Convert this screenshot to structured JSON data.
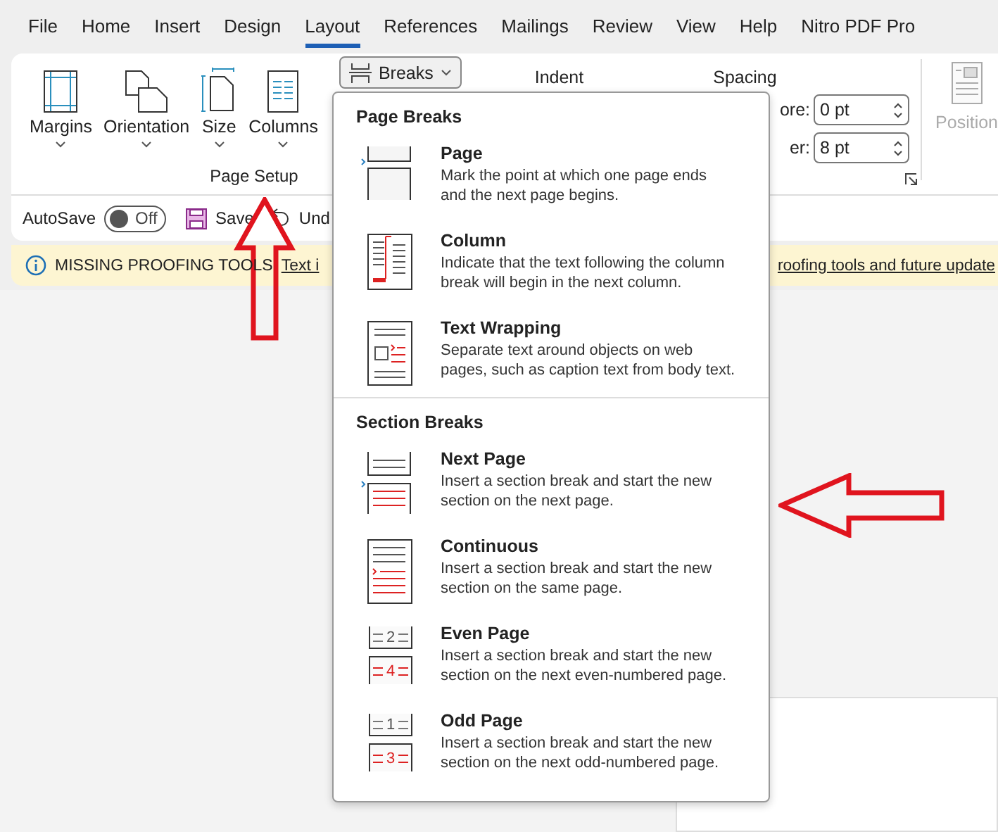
{
  "tabs": [
    {
      "label": "File",
      "selected": false
    },
    {
      "label": "Home",
      "selected": false
    },
    {
      "label": "Insert",
      "selected": false
    },
    {
      "label": "Design",
      "selected": false
    },
    {
      "label": "Layout",
      "selected": true
    },
    {
      "label": "References",
      "selected": false
    },
    {
      "label": "Mailings",
      "selected": false
    },
    {
      "label": "Review",
      "selected": false
    },
    {
      "label": "View",
      "selected": false
    },
    {
      "label": "Help",
      "selected": false
    },
    {
      "label": "Nitro PDF Pro",
      "selected": false
    }
  ],
  "ribbon": {
    "page_setup": {
      "buttons": [
        {
          "label": "Margins",
          "kind": "margins"
        },
        {
          "label": "Orientation",
          "kind": "orientation"
        },
        {
          "label": "Size",
          "kind": "size"
        },
        {
          "label": "Columns",
          "kind": "columns"
        }
      ],
      "breaks_button": {
        "label": "Breaks",
        "expanded": true
      },
      "group_label": "Page Setup"
    },
    "paragraph": {
      "indent_label": "Indent",
      "spacing_label": "Spacing",
      "spacing_fields": [
        {
          "label": "ore:",
          "value": "0 pt"
        },
        {
          "label": "er:",
          "value": "8 pt"
        }
      ]
    },
    "position_button": {
      "label": "Position",
      "disabled": true
    }
  },
  "quick_access": {
    "autosave_label": "AutoSave",
    "autosave": {
      "on": false,
      "label": "Off"
    },
    "save_label": "Save",
    "undo_label": "Und"
  },
  "message_bar": {
    "title": "MISSING PROOFING TOOLS",
    "link": "Text i",
    "link_tail": "roofing tools and future update"
  },
  "breaks_menu": {
    "sections": [
      {
        "title": "Page Breaks",
        "items": [
          {
            "kind": "page",
            "title": "Page",
            "description": [
              "Mark the point at which one page ends",
              "and the next page begins."
            ]
          },
          {
            "kind": "column",
            "title": "Column",
            "description": [
              "Indicate that the text following the column",
              "break will begin in the next column."
            ]
          },
          {
            "kind": "text-wrapping",
            "title": "Text Wrapping",
            "description": [
              "Separate text around objects on web",
              "pages, such as caption text from body text."
            ]
          }
        ]
      },
      {
        "title": "Section Breaks",
        "items": [
          {
            "kind": "next-page",
            "title": "Next Page",
            "description": [
              "Insert a section break and start the new",
              "section on the next page."
            ]
          },
          {
            "kind": "continuous",
            "title": "Continuous",
            "description": [
              "Insert a section break and start the new",
              "section on the same page."
            ]
          },
          {
            "kind": "even-page",
            "title": "Even Page",
            "icon_numbers": [
              "2",
              "4"
            ],
            "description": [
              "Insert a section break and start the new",
              "section on the next even-numbered page."
            ]
          },
          {
            "kind": "odd-page",
            "title": "Odd Page",
            "icon_numbers": [
              "1",
              "3"
            ],
            "description": [
              "Insert a section break and start the new",
              "section on the next odd-numbered page."
            ]
          }
        ]
      }
    ]
  }
}
